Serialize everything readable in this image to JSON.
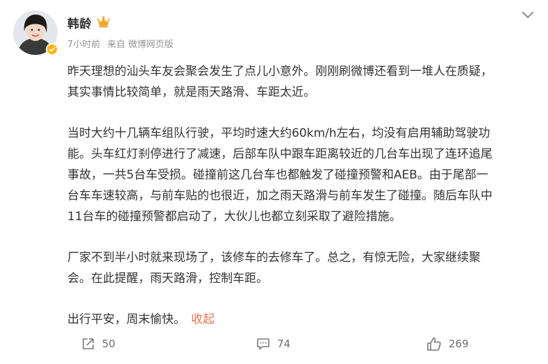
{
  "author": {
    "name": "韩龄",
    "time": "7小时前",
    "source": "来自 微博网页版"
  },
  "post": {
    "paragraphs": [
      "昨天理想的汕头车友会聚会发生了点儿小意外。刚刚刷微博还看到一堆人在质疑，\n其实事情比较简单，就是雨天路滑、车距太近。",
      "当时大约十几辆车组队行驶，平均时速大约60km/h左右，均没有启用辅助驾驶功\n能。头车红灯刹停进行了减速，后部车队中跟车距离较近的几台车出现了连环追尾\n事故，一共5台车受损。碰撞前这几台车也都触发了碰撞预警和AEB。由于尾部一\n台车车速较高，与前车贴的也很近，加之雨天路滑与前车发生了碰撞。随后车队中\n11台车的碰撞预警都启动了，大伙儿也都立刻采取了避险措施。",
      "厂家不到半小时就来现场了，该修车的去修车了。总之，有惊无险，大家继续聚\n会。在此提醒，雨天路滑，控制车距。",
      "出行平安，周末愉快。"
    ],
    "collapse_label": "收起"
  },
  "actions": {
    "repost_count": "50",
    "comment_count": "74",
    "like_count": "269"
  },
  "icons": {
    "more": "chevron-down-icon",
    "badge": "verified-badge-icon",
    "crown": "crown-icon",
    "repost": "repost-icon",
    "comment": "comment-icon",
    "like": "thumbs-up-icon"
  },
  "colors": {
    "link": "#eb7350",
    "badge": "#ffb400",
    "meta": "#939393"
  }
}
